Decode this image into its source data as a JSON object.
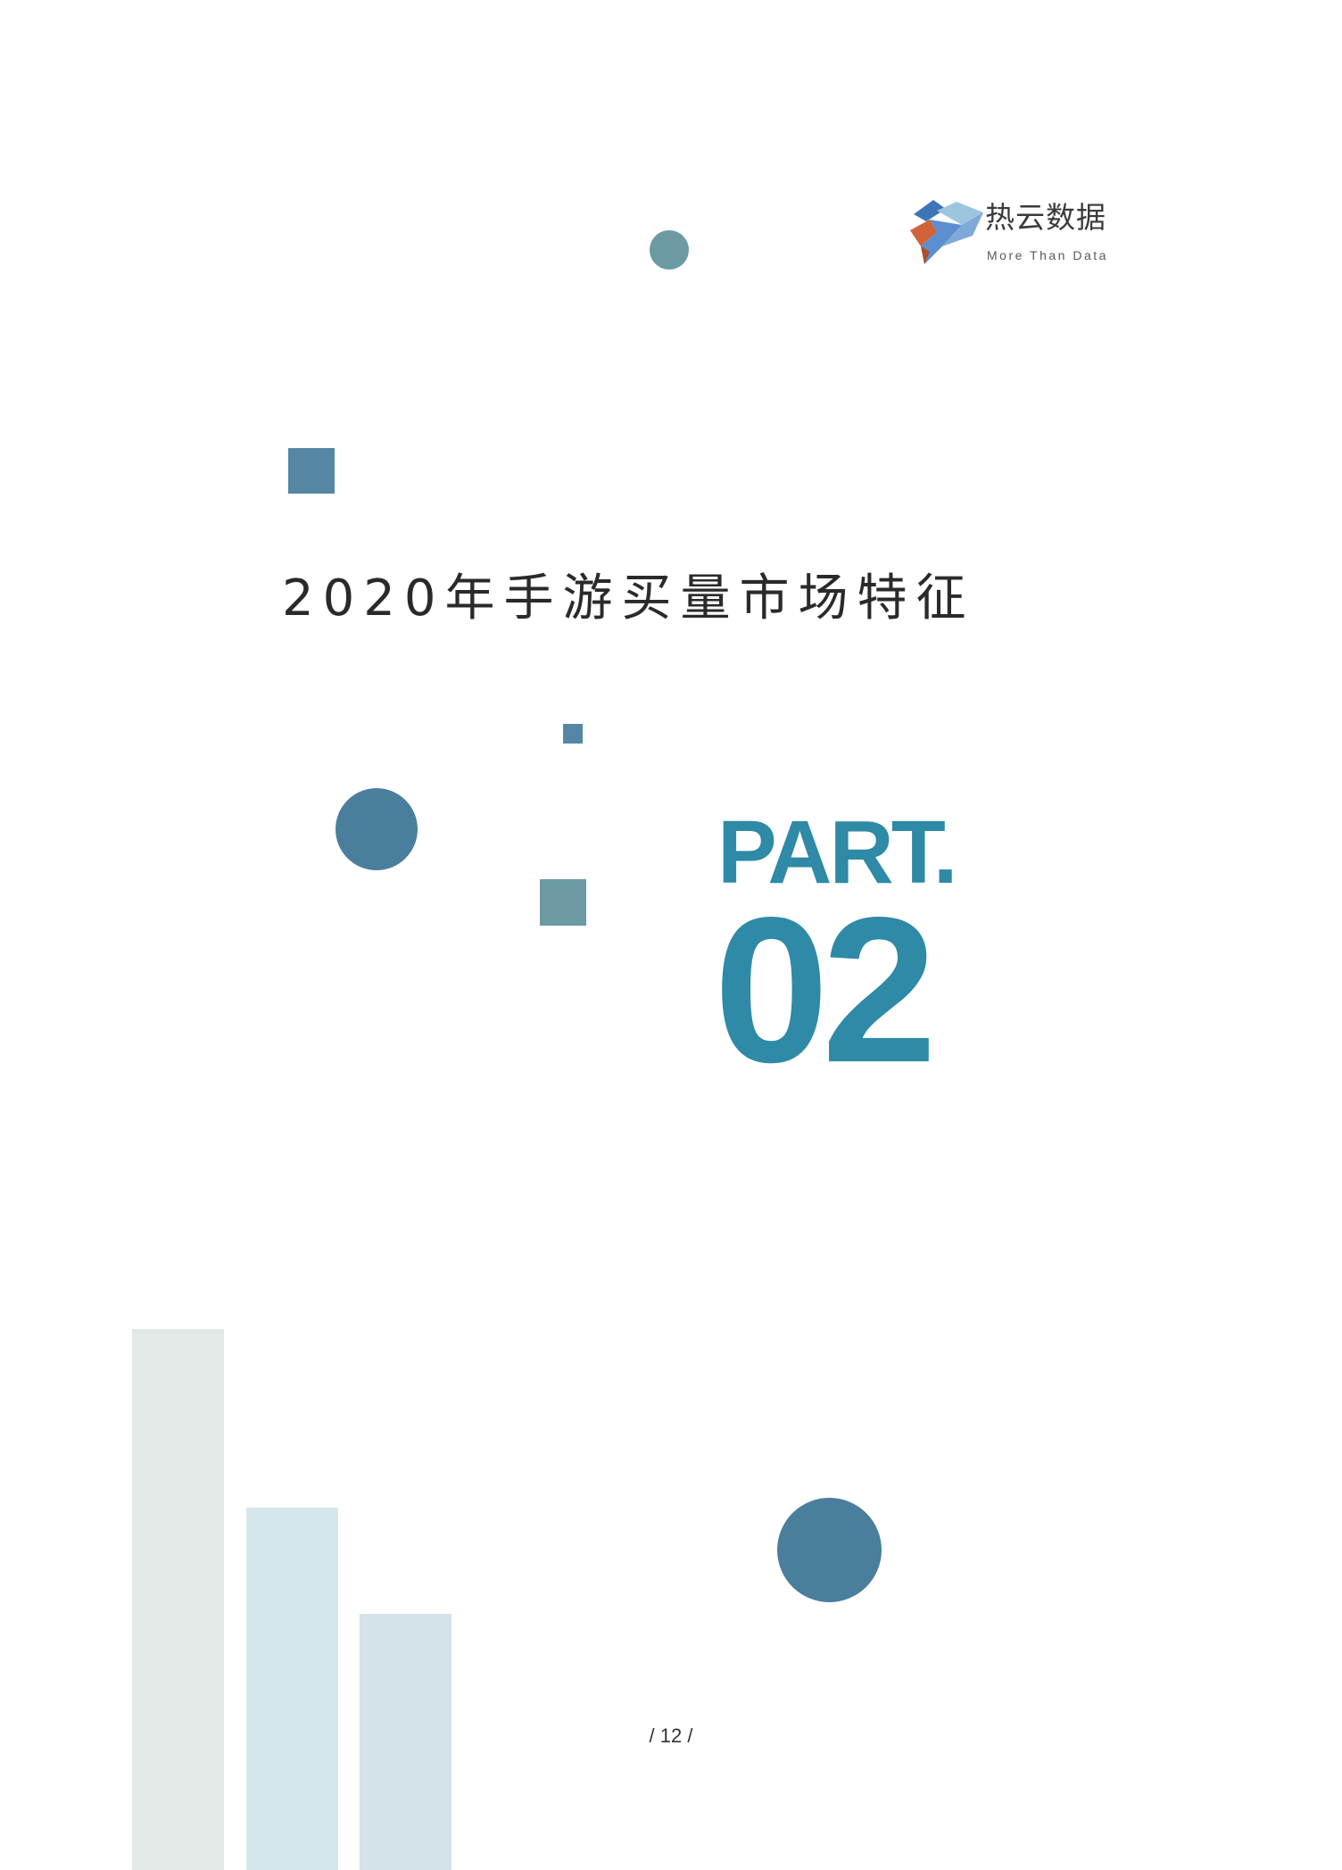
{
  "logo": {
    "name": "热云数据",
    "tagline": "More Than Data"
  },
  "section": {
    "title": "2020年手游买量市场特征",
    "part_label": "PART.",
    "part_number": "02"
  },
  "page": {
    "number_text": "/ 12 /"
  },
  "colors": {
    "accent": "#2e8aa6",
    "circle_dark": "#4a7e9d",
    "circle_teal": "#6b9aa3",
    "square_blue": "#5587a5",
    "bar_gray": "#e3e9e7",
    "bar_light_blue": "#d6e7ec"
  }
}
